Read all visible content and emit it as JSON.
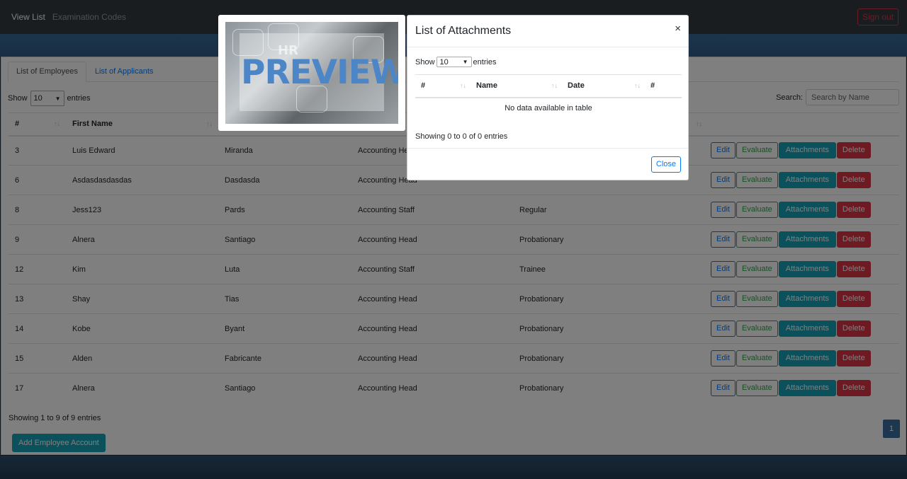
{
  "navbar": {
    "view_list": "View List",
    "examination_codes": "Examination Codes",
    "sign_out": "Sign out"
  },
  "tabs": [
    {
      "label": "List of Employees"
    },
    {
      "label": "List of Applicants"
    }
  ],
  "length_control": {
    "show": "Show",
    "value": "10",
    "entries": "entries"
  },
  "search": {
    "label": "Search:",
    "placeholder": "Search by Name"
  },
  "table": {
    "headers": [
      "#",
      "First Name"
    ],
    "rows": [
      {
        "id": "3",
        "first": "Luis Edward",
        "last": "Miranda",
        "position": "Accounting Head",
        "status": ""
      },
      {
        "id": "6",
        "first": "Asdasdasdasdas",
        "last": "Dasdasda",
        "position": "Accounting Head",
        "status": ""
      },
      {
        "id": "8",
        "first": "Jess123",
        "last": "Pards",
        "position": "Accounting Staff",
        "status": "Regular"
      },
      {
        "id": "9",
        "first": "Alnera",
        "last": "Santiago",
        "position": "Accounting Head",
        "status": "Probationary"
      },
      {
        "id": "12",
        "first": "Kim",
        "last": "Luta",
        "position": "Accounting Staff",
        "status": "Trainee"
      },
      {
        "id": "13",
        "first": "Shay",
        "last": "Tias",
        "position": "Accounting Head",
        "status": "Probationary"
      },
      {
        "id": "14",
        "first": "Kobe",
        "last": "Byant",
        "position": "Accounting Head",
        "status": "Probationary"
      },
      {
        "id": "15",
        "first": "Alden",
        "last": "Fabricante",
        "position": "Accounting Head",
        "status": "Probationary"
      },
      {
        "id": "17",
        "first": "Alnera",
        "last": "Santiago",
        "position": "Accounting Head",
        "status": "Probationary"
      }
    ],
    "actions": {
      "edit": "Edit",
      "evaluate": "Evaluate",
      "attachments": "Attachments",
      "delete": "Delete"
    }
  },
  "table_info": "Showing 1 to 9 of 9 entries",
  "add_button": "Add Employee Account",
  "pagination": {
    "current": "1"
  },
  "preview": {
    "hr_text": "HR",
    "watermark": "PREVIEW"
  },
  "modal": {
    "title": "List of Attachments",
    "close_x": "×",
    "length": {
      "show": "Show",
      "value": "10",
      "entries": "entries"
    },
    "headers": [
      "#",
      "Name",
      "Date",
      "#"
    ],
    "empty": "No data available in table",
    "info": "Showing 0 to 0 of 0 entries",
    "close_button": "Close"
  },
  "colors": {
    "primary": "#007bff",
    "info": "#17a2b8",
    "danger": "#dc3545",
    "success": "#28a745",
    "navbar": "#343a40"
  },
  "icons": {
    "sort": "sort-icon",
    "caret": "caret-down-icon"
  }
}
